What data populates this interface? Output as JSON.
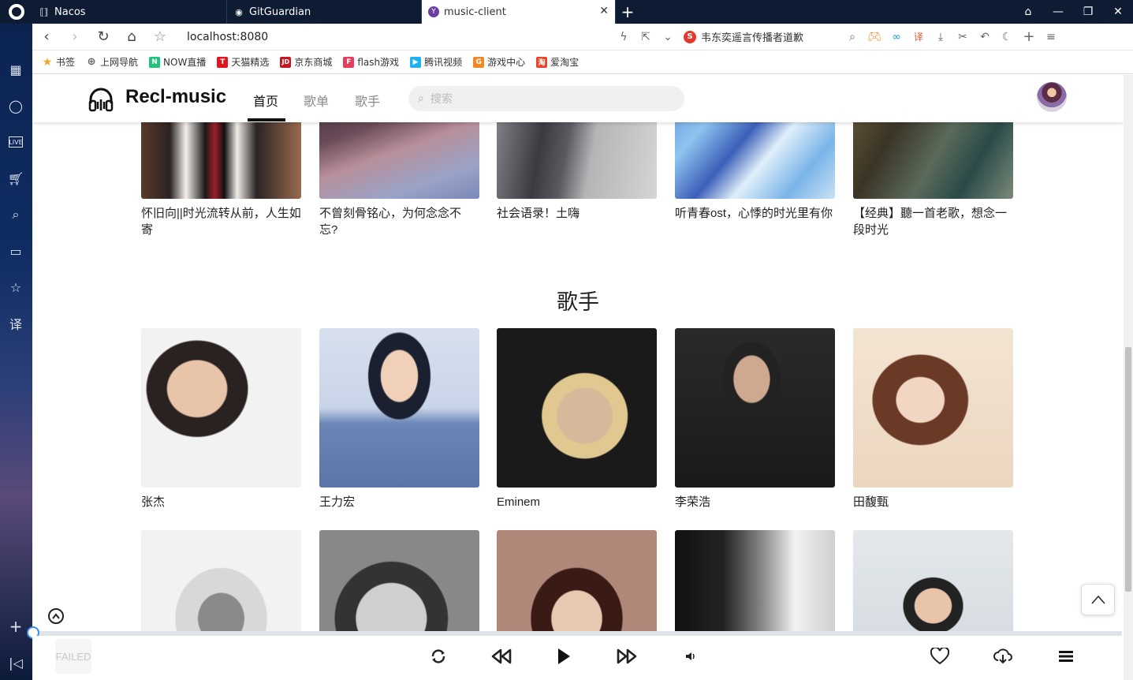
{
  "browser": {
    "tabs": [
      {
        "label": "Nacos"
      },
      {
        "label": "GitGuardian"
      },
      {
        "label": "music-client"
      }
    ],
    "url": "localhost:8080",
    "search_engine_text": "韦东奕遥言传播者道歉",
    "bookmarks": [
      "书签",
      "上网导航",
      "NOW直播",
      "天猫精选",
      "京东商城",
      "flash游戏",
      "腾讯视频",
      "游戏中心",
      "爱淘宝"
    ]
  },
  "app": {
    "brand": "Recl-music",
    "nav": [
      "首页",
      "歌单",
      "歌手"
    ],
    "search_placeholder": "搜索"
  },
  "playlists": [
    {
      "title": "怀旧向||时光流转从前，人生如寄"
    },
    {
      "title": "不曾刻骨铭心，为何念念不忘?"
    },
    {
      "title": "社会语录！土嗨"
    },
    {
      "title": "听青春ost，心悸的时光里有你"
    },
    {
      "title": "【经典】聽一首老歌，想念一段时光"
    }
  ],
  "singers_section_title": "歌手",
  "singers": [
    {
      "name": "张杰"
    },
    {
      "name": "王力宏"
    },
    {
      "name": "Eminem"
    },
    {
      "name": "李荣浩"
    },
    {
      "name": "田馥甄"
    }
  ],
  "player": {
    "status": "FAILED"
  },
  "colors": {
    "titlebar": "#0d1b33",
    "accent": "#3a8ee6",
    "nav_active": "#111111"
  }
}
